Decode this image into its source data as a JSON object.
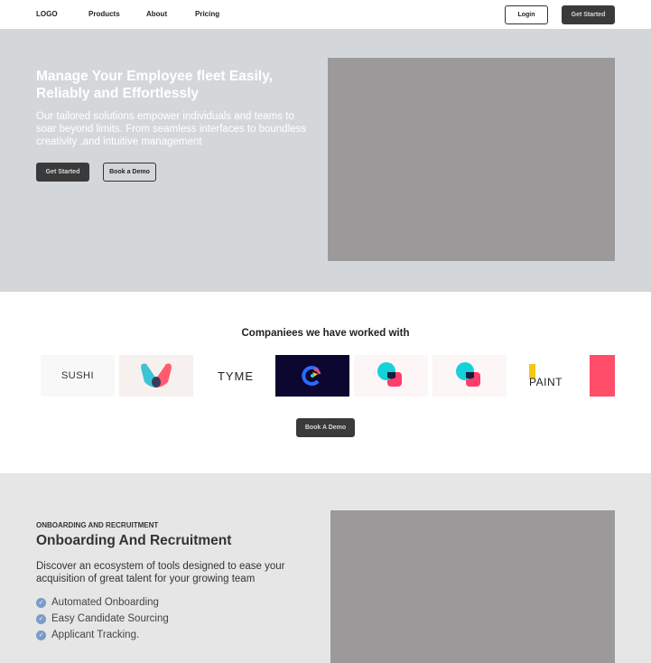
{
  "nav": {
    "logo": "LOGO",
    "links": [
      "Products",
      "About",
      "Pricing"
    ],
    "login": "Login",
    "get_started": "Get Started"
  },
  "hero": {
    "title": "Manage Your Employee fleet  Easily, Reliably and Effortlessly",
    "subtitle": "Our tailored solutions empower individuals and teams to soar beyond limits. From seamless interfaces to boundless creativity ,and intuitive management",
    "primary_button": "Get Started",
    "secondary_button": "Book a Demo"
  },
  "companies": {
    "title": "Companiees we have worked with",
    "logos": [
      "SUSHI",
      "M",
      "TYME",
      "C",
      "B",
      "B",
      "PAINT",
      ""
    ],
    "button": "Book A Demo"
  },
  "onboarding": {
    "eyebrow": "ONBOARDING AND RECRUITMENT",
    "title": "Onboarding And Recruitment",
    "description": "Discover an ecosystem of tools designed to ease  your acquisition of great talent for your growing team",
    "features": [
      "Automated Onboarding",
      "Easy Candidate Sourcing",
      "Applicant Tracking."
    ]
  }
}
